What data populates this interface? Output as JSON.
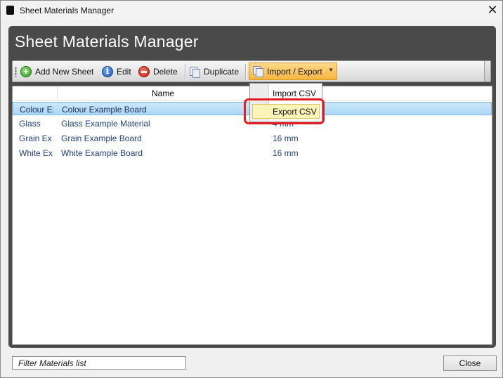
{
  "window": {
    "title": "Sheet Materials Manager",
    "close_glyph": "✕"
  },
  "panel": {
    "header": "Sheet Materials Manager"
  },
  "toolbar": {
    "add_label": "Add New Sheet",
    "add_icon": "plus-circle-icon",
    "edit_label": "Edit",
    "edit_icon": "info-icon",
    "delete_label": "Delete",
    "delete_icon": "minus-circle-icon",
    "duplicate_label": "Duplicate",
    "duplicate_icon": "copy-icon",
    "import_export_label": "Import / Export",
    "import_export_icon": "copy-icon",
    "caret_glyph": "▼"
  },
  "grid": {
    "columns": [
      "",
      "Name",
      ""
    ],
    "rows": [
      {
        "code": "Colour Ex",
        "name": "Colour Example Board",
        "thickness": "",
        "selected": true
      },
      {
        "code": "Glass",
        "name": "Glass Example Material",
        "thickness": "4 mm",
        "selected": false
      },
      {
        "code": "Grain Ex",
        "name": "Grain Example Board",
        "thickness": "16 mm",
        "selected": false
      },
      {
        "code": "White Ex",
        "name": "White Example Board",
        "thickness": "16 mm",
        "selected": false
      }
    ]
  },
  "import_export_menu": {
    "items": [
      "Import CSV",
      "Export CSV"
    ],
    "highlighted": "Export CSV"
  },
  "footer": {
    "filter_placeholder": "Filter Materials list",
    "close_label": "Close"
  },
  "colors": {
    "panel_bg": "#4a4a4a",
    "selection": "#a9d6f5",
    "menu_highlight": "#fbf3b7",
    "annotation_ring": "#e41b23",
    "import_button": "#f8b640"
  }
}
